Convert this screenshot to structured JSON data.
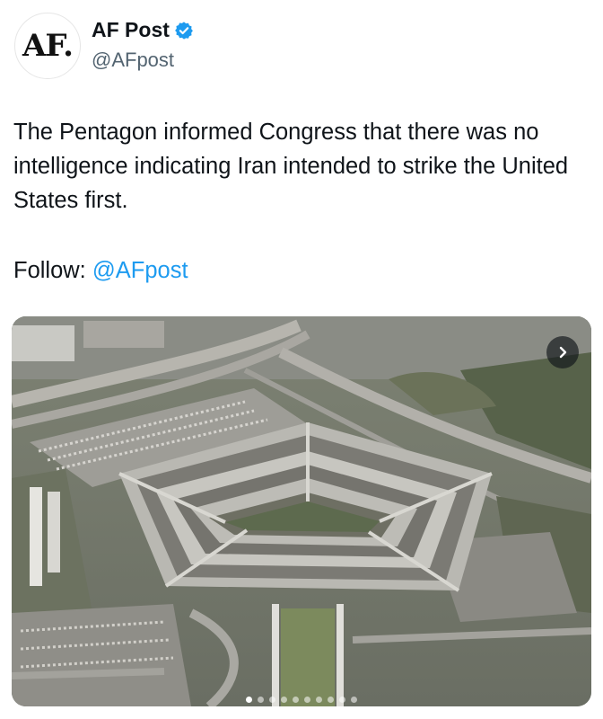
{
  "author": {
    "avatar_text": "AF.",
    "display_name": "AF Post",
    "handle": "@AFpost",
    "verified": true,
    "verified_color": "#1d9bf0"
  },
  "tweet": {
    "text": "The Pentagon informed Congress that there was no intelligence indicating Iran intended to strike the United States first.",
    "follow_label": "Follow:",
    "follow_mention": "@AFpost",
    "mention_color": "#1d9bf0"
  },
  "media": {
    "description_icon": "aerial-photo",
    "next_icon": "chevron-right-icon",
    "page_dot_count": 10,
    "active_dot_index": 0
  }
}
